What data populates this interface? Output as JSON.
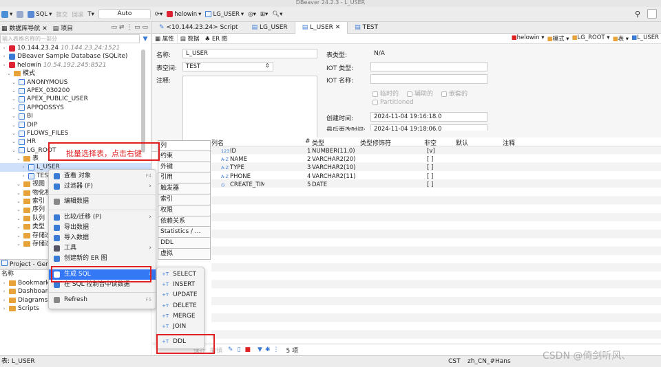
{
  "window": {
    "title": "DBeaver 24.2.3 - L_USER"
  },
  "toolbar": {
    "sql": "SQL",
    "commit": "提交",
    "rollback": "回滚",
    "tx_mode": "Auto",
    "conn": "helowin",
    "schema": "LG_USER"
  },
  "left": {
    "tab_nav": "数据库导航",
    "tab_project": "项目",
    "filter_placeholder": "输入表格名称的一部分",
    "tree": [
      {
        "lvl": 0,
        "icon": "db",
        "label": "10.144.23.24",
        "hint": "10.144.23.24:1521"
      },
      {
        "lvl": 0,
        "icon": "db2",
        "label": "DBeaver Sample Database (SQLite)",
        "hint": ""
      },
      {
        "lvl": 0,
        "icon": "db",
        "label": "helowin",
        "hint": "10.54.192.245:8521"
      },
      {
        "lvl": 1,
        "icon": "folder",
        "label": "模式",
        "hint": ""
      },
      {
        "lvl": 2,
        "icon": "schema",
        "label": "ANONYMOUS",
        "hint": ""
      },
      {
        "lvl": 2,
        "icon": "schema",
        "label": "APEX_030200",
        "hint": ""
      },
      {
        "lvl": 2,
        "icon": "schema",
        "label": "APEX_PUBLIC_USER",
        "hint": ""
      },
      {
        "lvl": 2,
        "icon": "schema",
        "label": "APPQOSSYS",
        "hint": ""
      },
      {
        "lvl": 2,
        "icon": "schema",
        "label": "BI",
        "hint": ""
      },
      {
        "lvl": 2,
        "icon": "schema",
        "label": "DIP",
        "hint": ""
      },
      {
        "lvl": 2,
        "icon": "schema",
        "label": "FLOWS_FILES",
        "hint": ""
      },
      {
        "lvl": 2,
        "icon": "schema",
        "label": "HR",
        "hint": ""
      },
      {
        "lvl": 2,
        "icon": "schema",
        "label": "LG_ROOT",
        "hint": ""
      },
      {
        "lvl": 3,
        "icon": "folder",
        "label": "表",
        "hint": ""
      },
      {
        "lvl": 4,
        "icon": "table",
        "label": "L_USER",
        "hint": ""
      },
      {
        "lvl": 4,
        "icon": "table",
        "label": "TEST",
        "hint": ""
      },
      {
        "lvl": 3,
        "icon": "folder",
        "label": "视图",
        "hint": ""
      },
      {
        "lvl": 3,
        "icon": "folder",
        "label": "物化视",
        "hint": ""
      },
      {
        "lvl": 3,
        "icon": "folder",
        "label": "索引",
        "hint": ""
      },
      {
        "lvl": 3,
        "icon": "folder",
        "label": "序列",
        "hint": ""
      },
      {
        "lvl": 3,
        "icon": "folder",
        "label": "队列",
        "hint": ""
      },
      {
        "lvl": 3,
        "icon": "folder",
        "label": "类型",
        "hint": ""
      },
      {
        "lvl": 3,
        "icon": "folder",
        "label": "存储过",
        "hint": ""
      },
      {
        "lvl": 3,
        "icon": "folder",
        "label": "存储过",
        "hint": ""
      }
    ],
    "project_title": "Project - Gene",
    "project_header": "名称",
    "project_items": [
      "Bookmarks",
      "Dashboards",
      "Diagrams",
      "Scripts"
    ]
  },
  "editor": {
    "tabs": [
      "<10.144.23.24> Script",
      "LG_USER",
      "L_USER",
      "TEST"
    ],
    "subtabs": [
      "属性",
      "数据",
      "ER 图"
    ],
    "breadcrumb": [
      "helowin",
      "模式",
      "LG_ROOT",
      "表",
      "L_USER"
    ],
    "props": {
      "name_label": "名称:",
      "name_value": "L_USER",
      "ts_label": "表空间:",
      "ts_value": "TEST",
      "comment_label": "注释:",
      "type_label": "表类型:",
      "type_value": "N/A",
      "iot_type_label": "IOT 类型:",
      "iot_name_label": "IOT 名称:",
      "chk_temp": "临时的",
      "chk_aux": "辅助的",
      "chk_nested": "嵌套的",
      "chk_part": "Partitioned",
      "created_label": "创建时间:",
      "created_value": "2024-11-04 19:16:18.0",
      "modified_label": "最后更改时间:",
      "modified_value": "2024-11-04 19:18:06.0"
    },
    "side_tabs": [
      "列",
      "约束",
      "外键",
      "引用",
      "触发器",
      "索引",
      "权限",
      "依赖关系",
      "Statistics / ...",
      "DDL",
      "虚拟"
    ],
    "grid_headers": [
      "列名",
      "#",
      "类型",
      "类型修饰符",
      "非空",
      "默认",
      "注释"
    ],
    "columns": [
      {
        "name": "ID",
        "icon": "123",
        "pos": "1",
        "type": "NUMBER(11,0)",
        "notnull": "[v]"
      },
      {
        "name": "NAME",
        "icon": "A-Z",
        "pos": "2",
        "type": "VARCHAR2(20)",
        "notnull": "[ ]"
      },
      {
        "name": "TYPE",
        "icon": "A-Z",
        "pos": "3",
        "type": "VARCHAR2(10)",
        "notnull": "[ ]"
      },
      {
        "name": "PHONE",
        "icon": "A-Z",
        "pos": "4",
        "type": "VARCHAR2(11)",
        "notnull": "[ ]"
      },
      {
        "name": "CREATE_TIM",
        "icon": "clock",
        "pos": "5",
        "type": "DATE",
        "notnull": "[ ]"
      }
    ],
    "bottom": {
      "save": "保存",
      "revert": "撤销",
      "count": "5 项"
    }
  },
  "context_menu": [
    {
      "label": "查看  对象",
      "shortcut": "F4",
      "arrow": false
    },
    {
      "label": "过滤器 (F)",
      "shortcut": "",
      "arrow": true
    },
    {
      "label": "编辑数据",
      "shortcut": "",
      "arrow": false
    },
    {
      "label": "比较/迁移 (P)",
      "shortcut": "",
      "arrow": true
    },
    {
      "label": "导出数据",
      "shortcut": "",
      "arrow": false
    },
    {
      "label": "导入数据",
      "shortcut": "",
      "arrow": false
    },
    {
      "label": "工具",
      "shortcut": "",
      "arrow": true
    },
    {
      "label": "创建新的 ER 图",
      "shortcut": "",
      "arrow": false
    },
    {
      "label": "生成 SQL",
      "shortcut": "",
      "arrow": true
    },
    {
      "label": "在 SQL 控制台中读数据",
      "shortcut": "",
      "arrow": false
    },
    {
      "label": "Refresh",
      "shortcut": "F5",
      "arrow": false
    }
  ],
  "sql_submenu": [
    "SELECT",
    "INSERT",
    "UPDATE",
    "DELETE",
    "MERGE",
    "JOIN",
    "DDL"
  ],
  "annotation": "批量选择表，点击右键",
  "status": {
    "left": "表: L_USER",
    "tz": "CST",
    "locale": "zh_CN_#Hans"
  },
  "watermark": "CSDN @倚剑听风、",
  "colors": {
    "highlight": "#3478f6",
    "annotation": "#e02020"
  }
}
